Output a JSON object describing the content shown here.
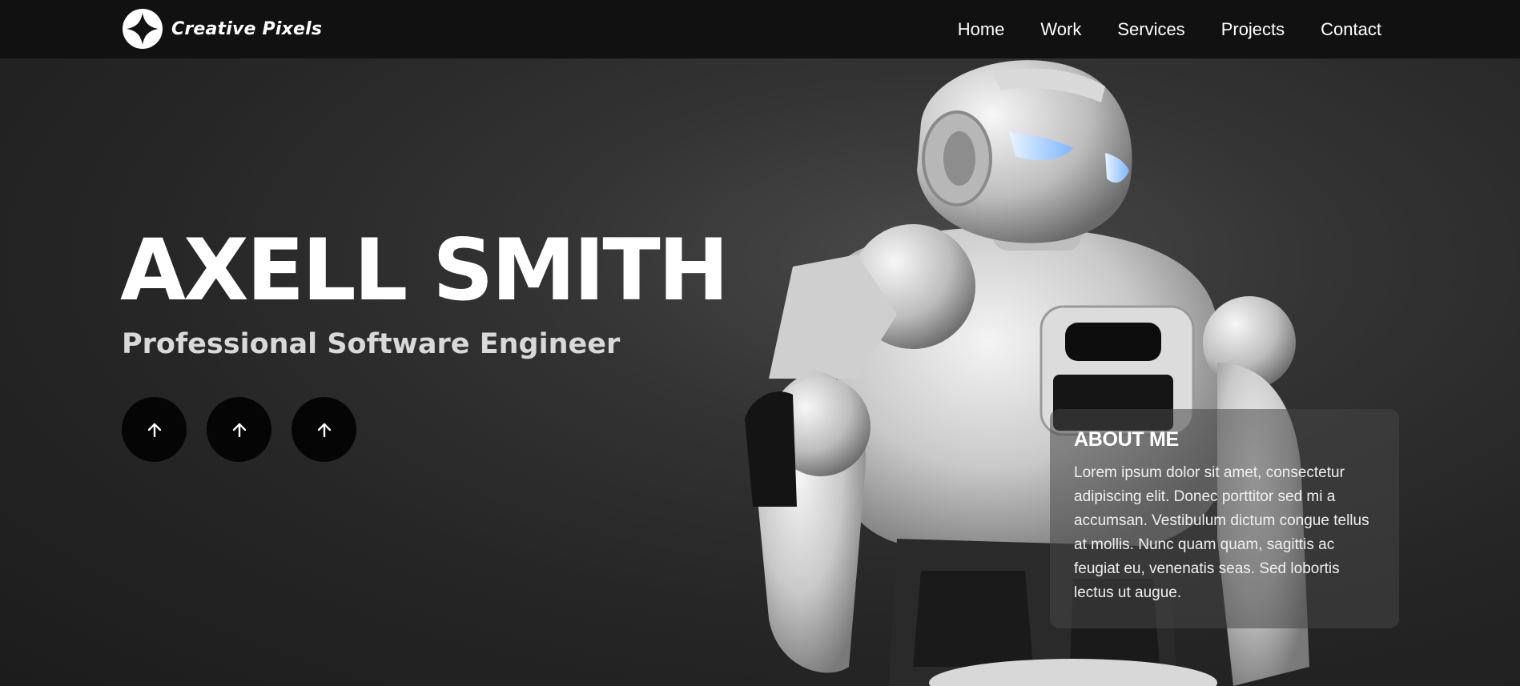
{
  "header": {
    "brand_name": "Creative Pixels",
    "logo_icon": "compass-star-icon",
    "nav": [
      {
        "label": "Home"
      },
      {
        "label": "Work"
      },
      {
        "label": "Services"
      },
      {
        "label": "Projects"
      },
      {
        "label": "Contact"
      }
    ]
  },
  "hero": {
    "name": "AXELL SMITH",
    "subtitle": "Professional Software Engineer",
    "buttons": [
      {
        "icon": "arrow-up-icon"
      },
      {
        "icon": "arrow-up-icon"
      },
      {
        "icon": "arrow-up-icon"
      }
    ],
    "image": "white-robot-photo"
  },
  "about": {
    "heading": "ABOUT ME",
    "text": "Lorem ipsum dolor sit amet, consectetur adipiscing elit. Donec porttitor sed mi a accumsan. Vestibulum dictum congue tellus at mollis. Nunc quam quam, sagittis ac feugiat eu, venenatis seas. Sed lobortis lectus ut augue."
  },
  "colors": {
    "header_bg": "#111111",
    "page_bg": "#2a2a2a",
    "button_bg": "#050505",
    "text": "#ffffff",
    "subtitle": "#d9d9d9"
  }
}
